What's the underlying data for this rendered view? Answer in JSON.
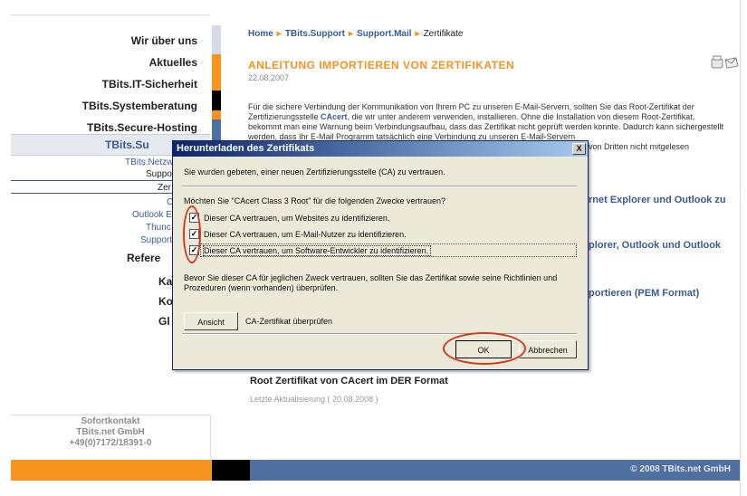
{
  "sidebar": {
    "items": [
      {
        "label": "Wir über uns",
        "color": "#d6dbe6"
      },
      {
        "label": "Aktuelles",
        "color": "#f7931e"
      },
      {
        "label": "TBits.IT-Sicherheit",
        "color": "#000000"
      },
      {
        "label": "TBits.Systemberatung",
        "color": "#f7931e"
      },
      {
        "label": "TBits.Secure-Hosting",
        "color": "#4f6fa0"
      }
    ],
    "active": "TBits.Su",
    "sub_items": [
      "TBits.Netzwerk",
      "Suppo",
      "Zer",
      "C",
      "Outlook Ex",
      "Thunc",
      "Support"
    ],
    "more_items": [
      "Refere",
      "Kai",
      "Ko",
      "Gl"
    ],
    "sofortkontakt": {
      "title": "Sofortkontakt",
      "company": "TBits.net GmbH",
      "phone": "+49(0)7172/18391-0"
    }
  },
  "breadcrumb": {
    "items": [
      "Home",
      "TBits.Support",
      "Support.Mail"
    ],
    "current": "Zertifikate"
  },
  "page": {
    "title": "ANLEITUNG IMPORTIEREN VON ZERTIFIKATEN",
    "date": "22.08.2007",
    "para_1": "Für die sichere Verbindung der Kommunikation von Ihrem PC zu unseren E-Mail-Servern, sollten Sie das Root-Zertifikat der Zertifizierungsstelle",
    "para_link": "CAcert",
    "para_2": ", die wir unter anderem verwenden, installieren. Ohne die Installation von diesem Root-Zertifikat, bekommt man eine Warnung beim Verbindungsaufbau, dass das Zertifikat nicht geprüft werden konnte. Dadurch kann sichergestellt werden, dass Ihr E-Mail Programm tatsächlich eine Verbindung zu unseren E-Mail-Servern",
    "para_tail": "von Dritten nicht mitgelesen",
    "right_link_1": "rnet Explorer und Outlook zu",
    "right_link_2": "plorer, Outlook und Outlook",
    "right_link_3": "portieren (PEM Format)",
    "root_link": "Root Zertifikat von CAcert im DER Format",
    "updated": "Letzte Aktualisierung ( 20.08.2008 )"
  },
  "footer": {
    "copyright": "© 2008 TBits.net GmbH",
    "colors": [
      "#f7931e",
      "#000000",
      "#4f6fa0"
    ]
  },
  "dialog": {
    "title": "Herunterladen des Zertifikats",
    "close": "X",
    "intro": "Sie wurden gebeten, einer neuen Zertifizierungsstelle (CA) zu vertrauen.",
    "question": "Möchten Sie \"CAcert Class 3 Root\" für die folgenden Zwecke vertrauen?",
    "checkboxes": [
      {
        "label": "Dieser CA vertrauen, um Websites zu identifizieren.",
        "checked": true
      },
      {
        "label": "Dieser CA vertrauen, um E-Mail-Nutzer zu identifizieren.",
        "checked": true
      },
      {
        "label": "Dieser CA vertrauen, um Software-Entwickler zu identifizieren.",
        "checked": true
      }
    ],
    "advice": "Bevor Sie dieser CA für jeglichen Zweck vertrauen, sollten Sie das Zertifikat sowie seine Richtlinien und Prozeduren (wenn vorhanden) überprüfen.",
    "view_button": "Ansicht",
    "view_label": "CA-Zertifikat überprüfen",
    "ok_button": "OK",
    "cancel_button": "Abbrechen",
    "highlight_color": "#d23a1e"
  }
}
